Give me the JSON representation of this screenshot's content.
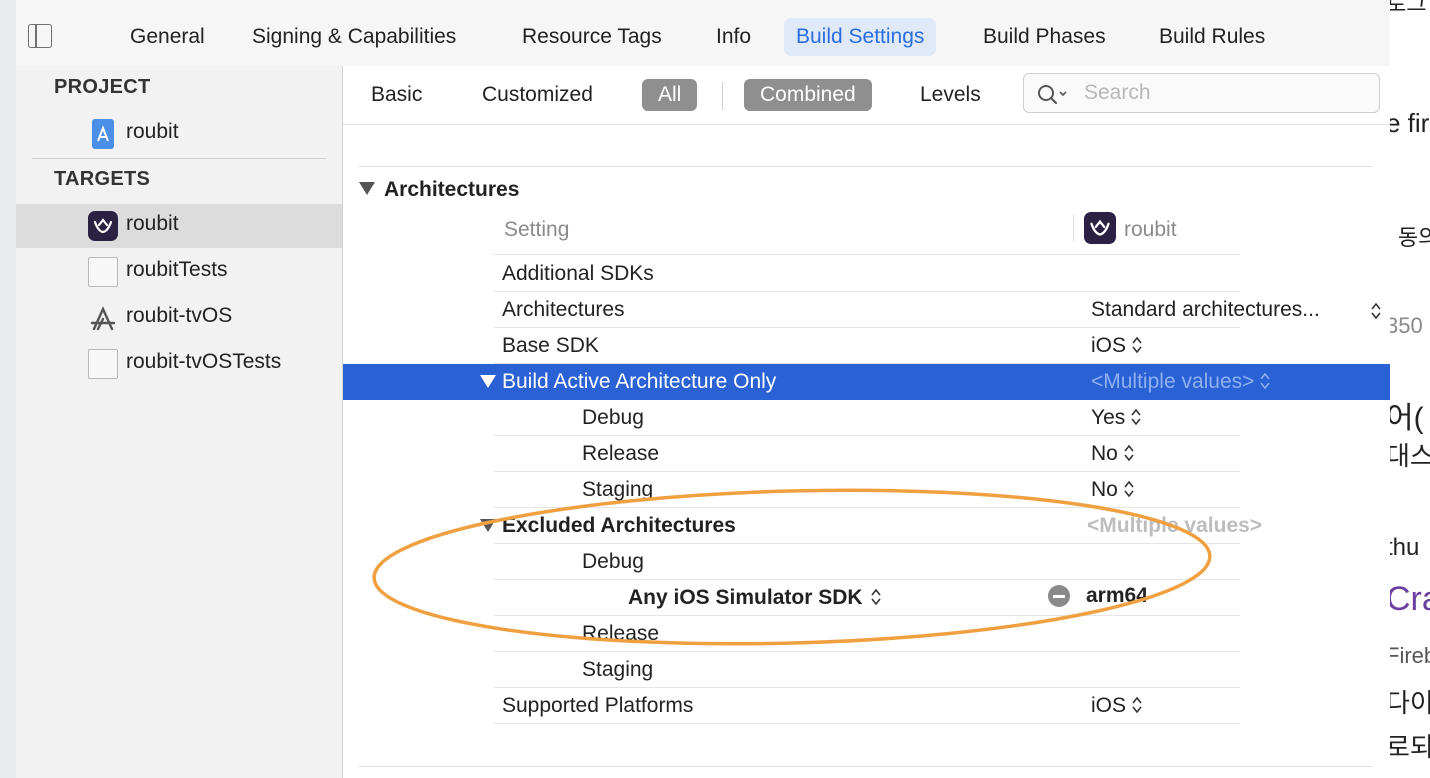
{
  "tabs": [
    "General",
    "Signing & Capabilities",
    "Resource Tags",
    "Info",
    "Build Settings",
    "Build Phases",
    "Build Rules"
  ],
  "active_tab": "Build Settings",
  "sidebar": {
    "project_header": "PROJECT",
    "project": "roubit",
    "targets_header": "TARGETS",
    "targets": [
      "roubit",
      "roubitTests",
      "roubit-tvOS",
      "roubit-tvOSTests"
    ],
    "selected_target": "roubit"
  },
  "filters": {
    "basic": "Basic",
    "customized": "Customized",
    "all": "All",
    "combined": "Combined",
    "levels": "Levels",
    "search_placeholder": "Search"
  },
  "section": {
    "title": "Architectures",
    "header_setting": "Setting",
    "header_target": "roubit"
  },
  "rows": {
    "additional_sdks": "Additional SDKs",
    "architectures": "Architectures",
    "architectures_value": "Standard architectures...",
    "base_sdk": "Base SDK",
    "base_sdk_value": "iOS",
    "baao": "Build Active Architecture Only",
    "baao_value": "<Multiple values>",
    "baao_debug": "Debug",
    "baao_debug_value": "Yes",
    "baao_release": "Release",
    "baao_release_value": "No",
    "baao_staging": "Staging",
    "baao_staging_value": "No",
    "excluded": "Excluded Architectures",
    "excluded_value": "<Multiple values>",
    "excl_debug": "Debug",
    "excl_sim": "Any iOS Simulator SDK",
    "excl_sim_value": "arm64",
    "excl_release": "Release",
    "excl_staging": "Staging",
    "platforms": "Supported Platforms",
    "platforms_value": "iOS"
  },
  "background_page_fragments": [
    "로그",
    "e fir",
    "| 동의",
    "350",
    "어(",
    "대스",
    "thu",
    "Cra",
    "Fireb",
    "다이어",
    "로되던"
  ],
  "colors": {
    "accent_blue": "#2a62d6",
    "tab_active_text": "#2a6de0",
    "annotation_orange": "#f0a040"
  }
}
